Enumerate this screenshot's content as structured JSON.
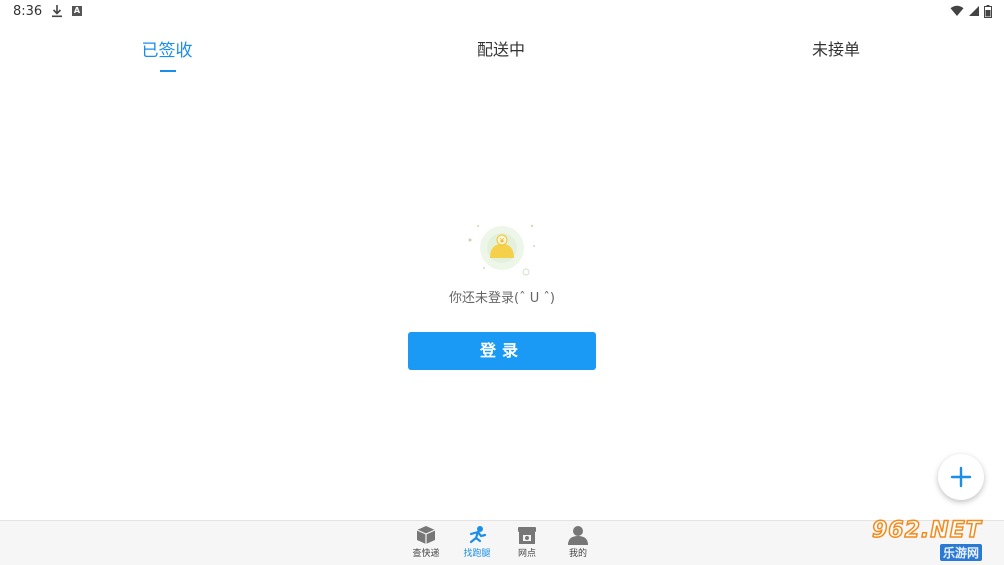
{
  "status_bar": {
    "time": "8:36",
    "icons": [
      "download-icon",
      "a-notification-icon",
      "wifi-icon",
      "signal-icon",
      "battery-icon"
    ]
  },
  "tabs": [
    {
      "label": "已签收",
      "active": true
    },
    {
      "label": "配送中",
      "active": false
    },
    {
      "label": "未接单",
      "active": false
    }
  ],
  "empty_state": {
    "message": "你还未登录(ˆ U ˆ)",
    "login_button": "登录"
  },
  "fab": {
    "icon": "plus-icon"
  },
  "bottom_nav": [
    {
      "label": "查快递",
      "icon": "package-icon",
      "active": false
    },
    {
      "label": "找跑腿",
      "icon": "runner-icon",
      "active": true
    },
    {
      "label": "网点",
      "icon": "store-icon",
      "active": false
    },
    {
      "label": "我的",
      "icon": "user-icon",
      "active": false
    }
  ],
  "watermark": {
    "main": "962.NET",
    "sub": "乐游网"
  },
  "colors": {
    "accent": "#1a8ee8",
    "button": "#1a99f5",
    "illustration_yellow": "#f5d04a"
  }
}
